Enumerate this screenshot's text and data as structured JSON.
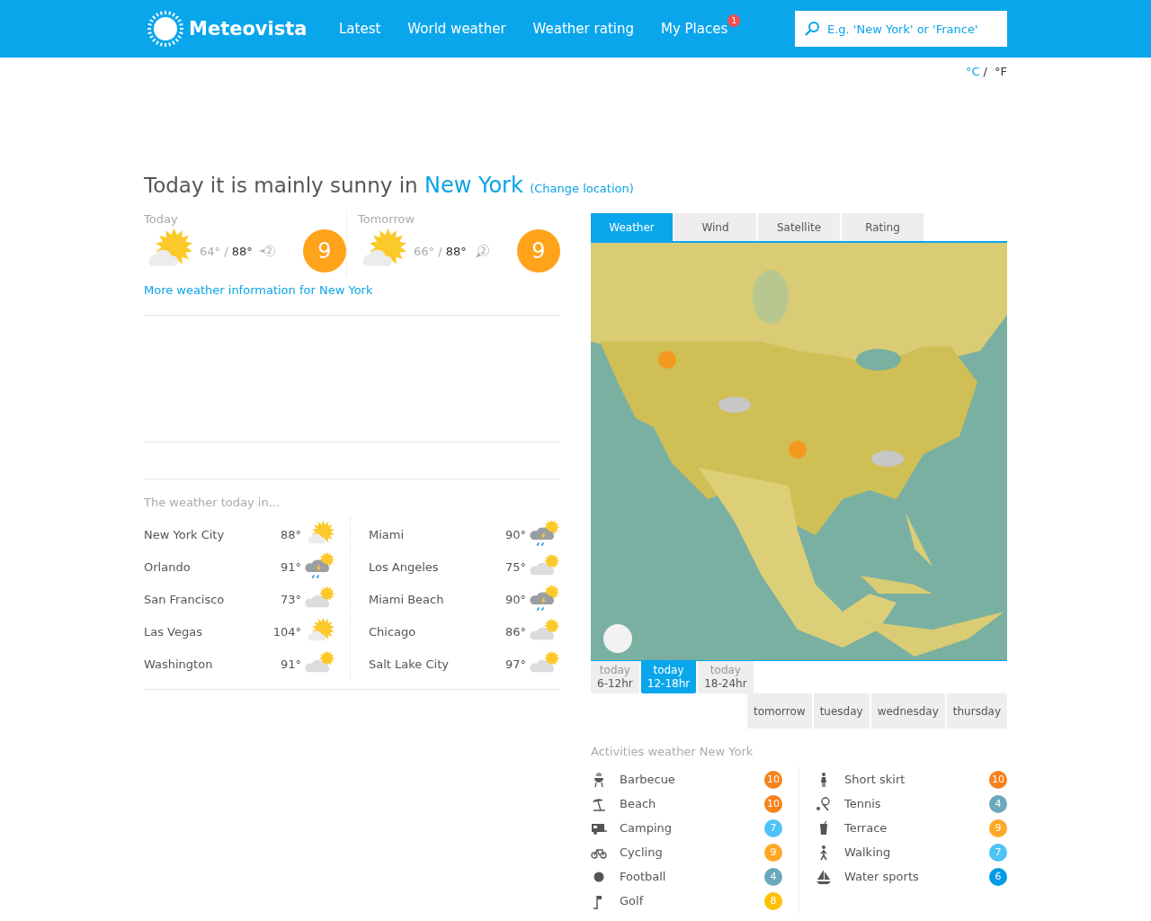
{
  "header": {
    "logo": "Meteovista",
    "nav": [
      {
        "label": "Latest"
      },
      {
        "label": "World weather"
      },
      {
        "label": "Weather rating"
      },
      {
        "label": "My Places",
        "badge": "1"
      }
    ],
    "search": {
      "placeholder": "E.g. 'New York' or 'France'"
    }
  },
  "units": [
    {
      "label": "°C",
      "selected": true
    },
    {
      "label": "°F",
      "selected": false
    }
  ],
  "units_separator": "/",
  "headline": {
    "text": "Today it is mainly sunny in",
    "place": "New York",
    "change_link": "(Change location)"
  },
  "forecast": [
    {
      "label": "Today",
      "kind": "sun-cloud",
      "low": "64°",
      "separator": "/",
      "high": "88°",
      "wind": "2",
      "rating": "9"
    },
    {
      "label": "Tomorrow",
      "kind": "sun-cloud",
      "low": "66°",
      "separator": "/",
      "high": "88°",
      "wind": "2",
      "rating": "9"
    }
  ],
  "more_link": "More weather information for New York",
  "cities": {
    "title": "The weather today in...",
    "columns": [
      [
        {
          "name": "New York City",
          "temp": "88°",
          "kind": "sun-cloud"
        },
        {
          "name": "Orlando",
          "temp": "91°",
          "kind": "storm"
        },
        {
          "name": "San Francisco",
          "temp": "73°",
          "kind": "cloud-sun"
        },
        {
          "name": "Las Vegas",
          "temp": "104°",
          "kind": "sun-cloud"
        },
        {
          "name": "Washington",
          "temp": "91°",
          "kind": "cloud-sun"
        }
      ],
      [
        {
          "name": "Miami",
          "temp": "90°",
          "kind": "storm"
        },
        {
          "name": "Los Angeles",
          "temp": "75°",
          "kind": "cloud-sun"
        },
        {
          "name": "Miami Beach",
          "temp": "90°",
          "kind": "storm"
        },
        {
          "name": "Chicago",
          "temp": "86°",
          "kind": "cloud-sun"
        },
        {
          "name": "Salt Lake City",
          "temp": "97°",
          "kind": "cloud-sun"
        }
      ]
    ]
  },
  "map_tabs": [
    {
      "label": "Weather",
      "selected": true
    },
    {
      "label": "Wind",
      "selected": false
    },
    {
      "label": "Satellite",
      "selected": false
    },
    {
      "label": "Rating",
      "selected": false
    }
  ],
  "time_tabs": [
    {
      "day": "today",
      "hours": "6-12hr",
      "selected": false
    },
    {
      "day": "today",
      "hours": "12-18hr",
      "selected": true
    },
    {
      "day": "today",
      "hours": "18-24hr",
      "selected": false
    }
  ],
  "day_tabs": [
    {
      "label": "tomorrow",
      "selected": false
    },
    {
      "label": "tuesday",
      "selected": false
    },
    {
      "label": "wednesday",
      "selected": false
    },
    {
      "label": "thursday",
      "selected": false
    }
  ],
  "activities": {
    "title": "Activities weather New York",
    "columns": [
      [
        {
          "kind": "grill",
          "name": "Barbecue",
          "score": "10",
          "color": "#f7821b"
        },
        {
          "kind": "umbrella",
          "name": "Beach",
          "score": "10",
          "color": "#f7821b"
        },
        {
          "kind": "caravan",
          "name": "Camping",
          "score": "7",
          "color": "#4fc3f7"
        },
        {
          "kind": "bicycle",
          "name": "Cycling",
          "score": "9",
          "color": "#ffa726"
        },
        {
          "kind": "ball",
          "name": "Football",
          "score": "4",
          "color": "#6aa8bc"
        },
        {
          "kind": "flag",
          "name": "Golf",
          "score": "8",
          "color": "#ffc107"
        }
      ],
      [
        {
          "kind": "person",
          "name": "Short skirt",
          "score": "10",
          "color": "#f7821b"
        },
        {
          "kind": "racket",
          "name": "Tennis",
          "score": "4",
          "color": "#6aa8bc"
        },
        {
          "kind": "glass",
          "name": "Terrace",
          "score": "9",
          "color": "#ffa726"
        },
        {
          "kind": "walker",
          "name": "Walking",
          "score": "7",
          "color": "#4fc3f7"
        },
        {
          "kind": "boat",
          "name": "Water sports",
          "score": "6",
          "color": "#039be5"
        }
      ]
    ]
  }
}
